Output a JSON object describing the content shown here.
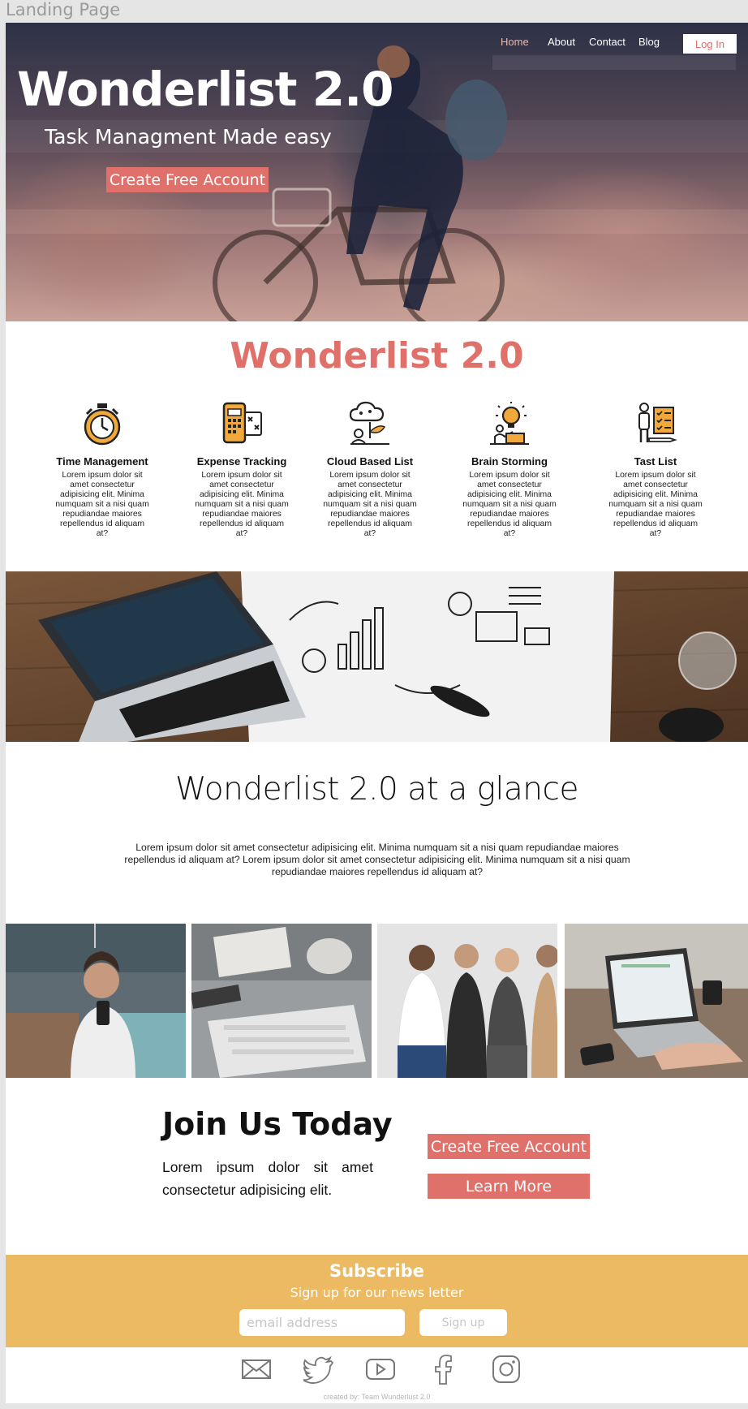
{
  "frame_label": "Landing Page",
  "nav": {
    "home": "Home",
    "about": "About",
    "contact": "Contact",
    "blog": "Blog",
    "login": "Log In"
  },
  "hero": {
    "title": "Wonderlist 2.0",
    "subtitle": "Task Managment Made easy",
    "cta": "Create Free Account"
  },
  "features": {
    "title": "Wonderlist 2.0",
    "items": [
      {
        "icon": "stopwatch-icon",
        "title": "Time Management",
        "text": "Lorem ipsum dolor sit amet consectetur adipisicing elit. Minima numquam sit a nisi quam repudiandae maiores repellendus id aliquam at?"
      },
      {
        "icon": "calculator-phone-icon",
        "title": "Expense Tracking",
        "text": "Lorem ipsum dolor sit amet consectetur adipisicing elit. Minima numquam sit a nisi quam repudiandae maiores repellendus id aliquam at?"
      },
      {
        "icon": "cloud-plant-icon",
        "title": "Cloud Based List",
        "text": "Lorem ipsum dolor sit amet consectetur adipisicing elit. Minima numquam sit a nisi quam repudiandae maiores repellendus id aliquam at?"
      },
      {
        "icon": "lightbulb-icon",
        "title": "Brain Storming",
        "text": "Lorem ipsum dolor sit amet consectetur adipisicing elit. Minima numquam sit a nisi quam repudiandae maiores repellendus id aliquam at?"
      },
      {
        "icon": "checklist-person-icon",
        "title": "Tast List",
        "text": "Lorem ipsum dolor sit amet consectetur adipisicing elit. Minima numquam sit a nisi quam repudiandae maiores repellendus id aliquam at?"
      }
    ]
  },
  "glance": {
    "title": "Wonderlist 2.0 at a glance",
    "text": "Lorem ipsum dolor sit amet consectetur adipisicing elit. Minima numquam sit a nisi quam repudiandae maiores repellendus id aliquam at? Lorem ipsum dolor sit amet consectetur adipisicing elit. Minima numquam sit a nisi quam repudiandae maiores repellendus id aliquam at?"
  },
  "join": {
    "title": "Join Us Today",
    "text": "Lorem ipsum dolor sit amet consectetur adipisicing elit.",
    "cta_primary": "Create Free Account",
    "cta_secondary": "Learn More"
  },
  "subscribe": {
    "title": "Subscribe",
    "subtitle": "Sign up for our news letter",
    "email_placeholder": "email address",
    "button": "Sign up"
  },
  "social": [
    "mail-icon",
    "twitter-icon",
    "youtube-icon",
    "facebook-icon",
    "instagram-icon"
  ],
  "footer": {
    "credit": "created by:  Team Wunderlust 2.0"
  },
  "colors": {
    "accent": "#e0706a",
    "subscribe_bg": "#ebba63",
    "icon_orange": "#f0a93a"
  }
}
